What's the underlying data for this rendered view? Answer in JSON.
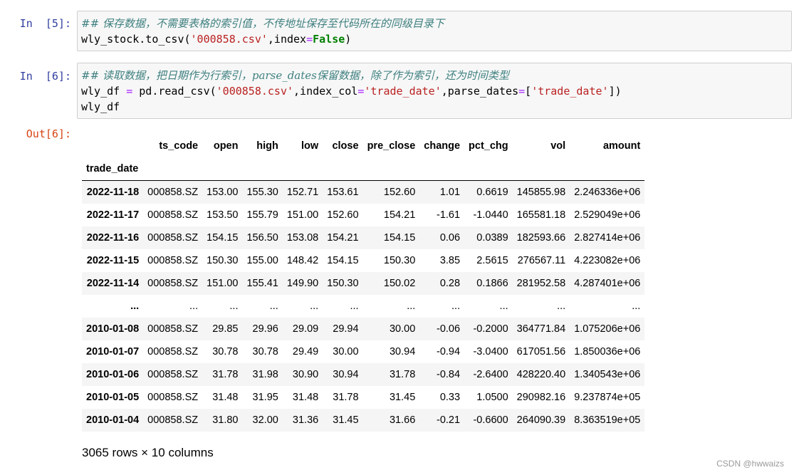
{
  "cells": [
    {
      "prompt": "In  [5]:",
      "comment": "## 保存数据，不需要表格的索引值，不传地址保存至代码所在的同级目录下",
      "line2": {
        "pre": "wly_stock.to_csv(",
        "str": "'000858.csv'",
        "mid": ",index",
        "eq": "=",
        "kw": "False",
        "post": ")"
      }
    },
    {
      "prompt": "In  [6]:",
      "comment": "## 读取数据，把日期作为行索引，parse_dates保留数据，除了作为索引，还为时间类型",
      "line2": {
        "a": "wly_df ",
        "eq1": "=",
        "b": " pd.read_csv(",
        "s1": "'000858.csv'",
        "c": ",index_col",
        "eq2": "=",
        "s2": "'trade_date'",
        "d": ",parse_dates",
        "eq3": "=",
        "e": "[",
        "s3": "'trade_date'",
        "f": "])"
      },
      "line3": "wly_df"
    }
  ],
  "output_prompt": "Out[6]:",
  "table": {
    "columns": [
      "ts_code",
      "open",
      "high",
      "low",
      "close",
      "pre_close",
      "change",
      "pct_chg",
      "vol",
      "amount"
    ],
    "index_name": "trade_date",
    "rows": [
      [
        "2022-11-18",
        "000858.SZ",
        "153.00",
        "155.30",
        "152.71",
        "153.61",
        "152.60",
        "1.01",
        "0.6619",
        "145855.98",
        "2.246336e+06"
      ],
      [
        "2022-11-17",
        "000858.SZ",
        "153.50",
        "155.79",
        "151.00",
        "152.60",
        "154.21",
        "-1.61",
        "-1.0440",
        "165581.18",
        "2.529049e+06"
      ],
      [
        "2022-11-16",
        "000858.SZ",
        "154.15",
        "156.50",
        "153.08",
        "154.21",
        "154.15",
        "0.06",
        "0.0389",
        "182593.66",
        "2.827414e+06"
      ],
      [
        "2022-11-15",
        "000858.SZ",
        "150.30",
        "155.00",
        "148.42",
        "154.15",
        "150.30",
        "3.85",
        "2.5615",
        "276567.11",
        "4.223082e+06"
      ],
      [
        "2022-11-14",
        "000858.SZ",
        "151.00",
        "155.41",
        "149.90",
        "150.30",
        "150.02",
        "0.28",
        "0.1866",
        "281952.58",
        "4.287401e+06"
      ],
      [
        "...",
        "...",
        "...",
        "...",
        "...",
        "...",
        "...",
        "...",
        "...",
        "...",
        "..."
      ],
      [
        "2010-01-08",
        "000858.SZ",
        "29.85",
        "29.96",
        "29.09",
        "29.94",
        "30.00",
        "-0.06",
        "-0.2000",
        "364771.84",
        "1.075206e+06"
      ],
      [
        "2010-01-07",
        "000858.SZ",
        "30.78",
        "30.78",
        "29.49",
        "30.00",
        "30.94",
        "-0.94",
        "-3.0400",
        "617051.56",
        "1.850036e+06"
      ],
      [
        "2010-01-06",
        "000858.SZ",
        "31.78",
        "31.98",
        "30.90",
        "30.94",
        "31.78",
        "-0.84",
        "-2.6400",
        "428220.40",
        "1.340543e+06"
      ],
      [
        "2010-01-05",
        "000858.SZ",
        "31.48",
        "31.95",
        "31.48",
        "31.78",
        "31.45",
        "0.33",
        "1.0500",
        "290982.16",
        "9.237874e+05"
      ],
      [
        "2010-01-04",
        "000858.SZ",
        "31.80",
        "32.00",
        "31.36",
        "31.45",
        "31.66",
        "-0.21",
        "-0.6600",
        "264090.39",
        "8.363519e+05"
      ]
    ]
  },
  "shape_text": "3065 rows × 10 columns",
  "watermark": "CSDN @hwwaizs"
}
